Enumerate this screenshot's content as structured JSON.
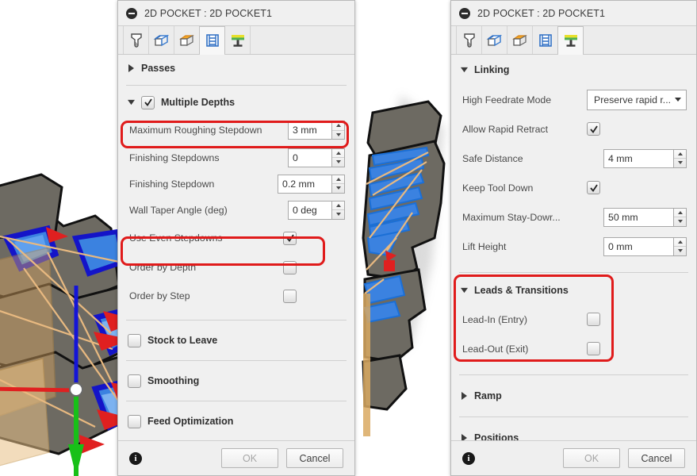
{
  "app": {
    "accent_red": "#e01b1b",
    "panel_bg": "#f0f0f0"
  },
  "left_panel": {
    "title": "2D POCKET : 2D POCKET1",
    "tabs": [
      {
        "name": "tool-tab",
        "label": "Tool"
      },
      {
        "name": "geometry-tab",
        "label": "Geometry"
      },
      {
        "name": "heights-tab",
        "label": "Heights"
      },
      {
        "name": "passes-tab",
        "label": "Passes",
        "active": true
      },
      {
        "name": "linking-tab",
        "label": "Linking"
      }
    ],
    "groups": {
      "passes": {
        "label": "Passes",
        "expanded": false
      },
      "multiple_depths": {
        "label": "Multiple Depths",
        "expanded": true,
        "checked": true
      },
      "stock_to_leave": {
        "label": "Stock to Leave",
        "checked": false
      },
      "smoothing": {
        "label": "Smoothing",
        "checked": false
      },
      "feed_optimization": {
        "label": "Feed Optimization",
        "checked": false
      }
    },
    "fields": [
      {
        "label": "Maximum Roughing Stepdown",
        "value": "3 mm",
        "type": "number"
      },
      {
        "label": "Finishing Stepdowns",
        "value": "0",
        "type": "number"
      },
      {
        "label": "Finishing Stepdown",
        "value": "0.2 mm",
        "type": "number"
      },
      {
        "label": "Wall Taper Angle (deg)",
        "value": "0 deg",
        "type": "number"
      },
      {
        "label": "Use Even Stepdowns",
        "value": true,
        "type": "checkbox"
      },
      {
        "label": "Order by Depth",
        "value": false,
        "type": "checkbox"
      },
      {
        "label": "Order by Step",
        "value": false,
        "type": "checkbox"
      }
    ],
    "footer": {
      "info": "i",
      "ok": "OK",
      "cancel": "Cancel"
    }
  },
  "right_panel": {
    "title": "2D POCKET : 2D POCKET1",
    "tabs": [
      {
        "name": "tool-tab",
        "label": "Tool"
      },
      {
        "name": "geometry-tab",
        "label": "Geometry"
      },
      {
        "name": "heights-tab",
        "label": "Heights"
      },
      {
        "name": "passes-tab",
        "label": "Passes"
      },
      {
        "name": "linking-tab",
        "label": "Linking",
        "active": true
      }
    ],
    "groups": {
      "linking": {
        "label": "Linking",
        "expanded": true
      },
      "leads_transitions": {
        "label": "Leads & Transitions",
        "expanded": true
      },
      "ramp": {
        "label": "Ramp",
        "expanded": false
      },
      "positions": {
        "label": "Positions",
        "expanded": false
      }
    },
    "fields": [
      {
        "label": "High Feedrate Mode",
        "value": "Preserve rapid r...",
        "type": "combo"
      },
      {
        "label": "Allow Rapid Retract",
        "value": true,
        "type": "checkbox"
      },
      {
        "label": "Safe Distance",
        "value": "4 mm",
        "type": "number"
      },
      {
        "label": "Keep Tool Down",
        "value": true,
        "type": "checkbox"
      },
      {
        "label": "Maximum Stay-Dowr...",
        "value": "50 mm",
        "type": "number"
      },
      {
        "label": "Lift Height",
        "value": "0 mm",
        "type": "number"
      }
    ],
    "leads_fields": [
      {
        "label": "Lead-In (Entry)",
        "value": false,
        "type": "checkbox"
      },
      {
        "label": "Lead-Out (Exit)",
        "value": false,
        "type": "checkbox"
      }
    ],
    "footer": {
      "info": "i",
      "ok": "OK",
      "cancel": "Cancel"
    }
  },
  "annotations": [
    {
      "name": "annotation-maximum-roughing-stepdown",
      "target": "Maximum Roughing Stepdown"
    },
    {
      "name": "annotation-use-even-stepdowns",
      "target": "Use Even Stepdowns"
    },
    {
      "name": "annotation-leads-and-transitions",
      "target": "Leads & Transitions"
    }
  ]
}
